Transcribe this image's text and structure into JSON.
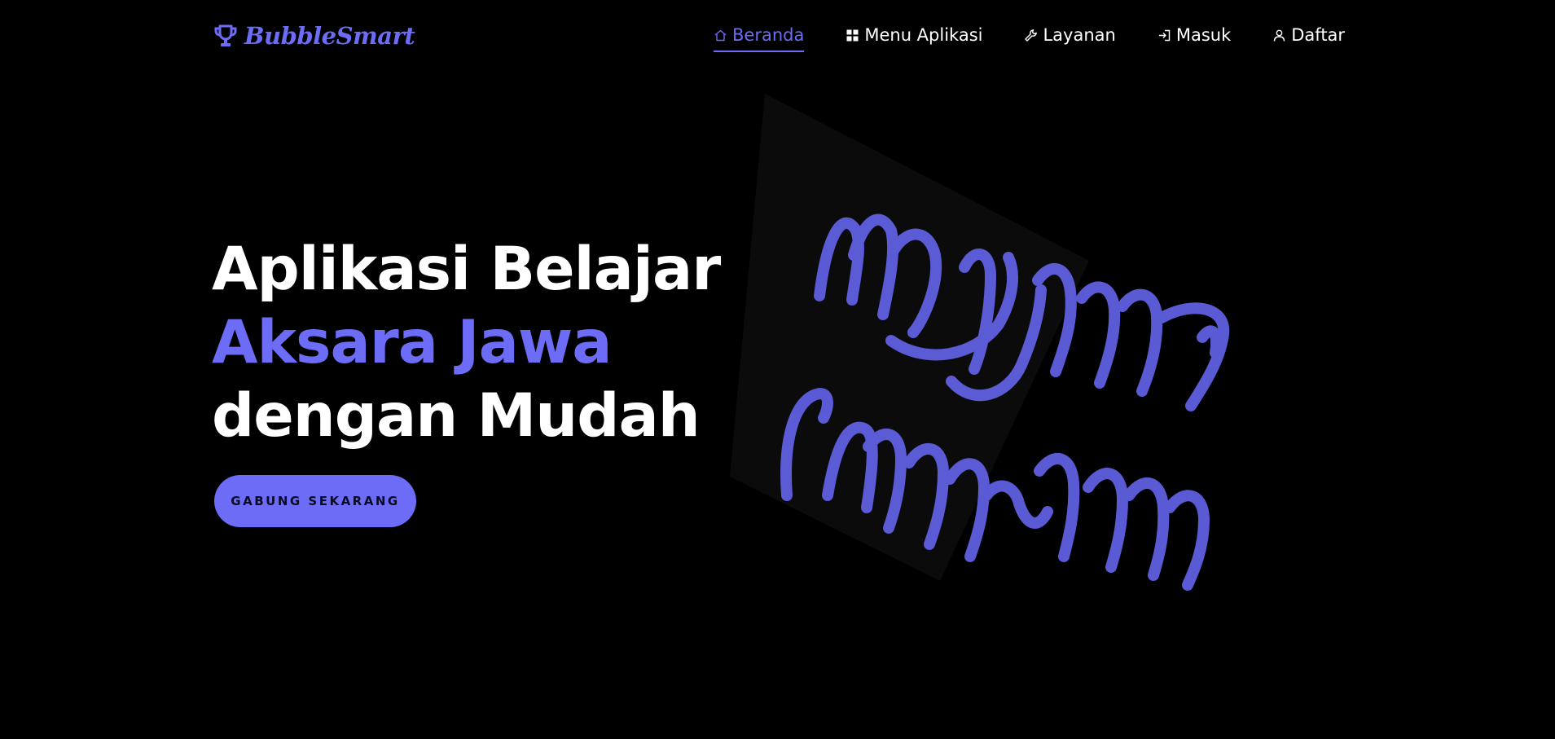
{
  "brand": {
    "name": "BubbleSmart",
    "icon": "trophy-icon",
    "color": "#6c6cf7"
  },
  "nav": {
    "items": [
      {
        "label": "Beranda",
        "icon": "home-icon",
        "active": true
      },
      {
        "label": "Menu Aplikasi",
        "icon": "grid-icon",
        "active": false
      },
      {
        "label": "Layanan",
        "icon": "wrench-icon",
        "active": false
      },
      {
        "label": "Masuk",
        "icon": "login-icon",
        "active": false
      },
      {
        "label": "Daftar",
        "icon": "user-icon",
        "active": false
      }
    ]
  },
  "hero": {
    "line1": "Aplikasi Belajar",
    "line2": "Aksara Jawa",
    "line3": "dengan Mudah",
    "cta_label": "GABUNG SEKARANG"
  },
  "theme": {
    "accent": "#6c6cf7",
    "background": "#000000",
    "text": "#ffffff"
  }
}
